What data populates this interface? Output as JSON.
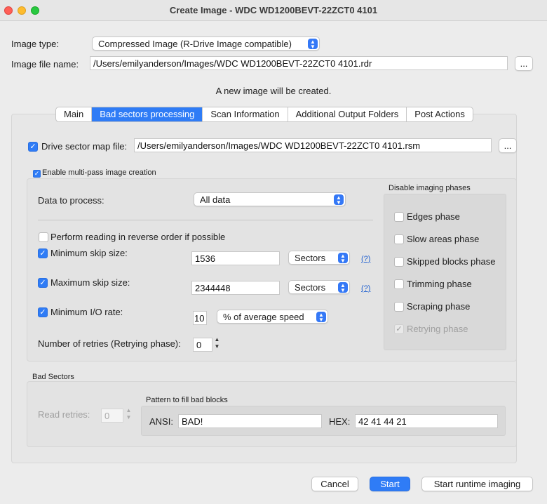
{
  "window": {
    "title": "Create Image - WDC WD1200BEVT-22ZCT0 4101"
  },
  "image_type": {
    "label": "Image type:",
    "value": "Compressed Image (R-Drive Image compatible)"
  },
  "image_file": {
    "label": "Image file name:",
    "value": "/Users/emilyanderson/Images/WDC WD1200BEVT-22ZCT0 4101.rdr",
    "browse": "..."
  },
  "notice": "A new image will be created.",
  "tabs": [
    {
      "label": "Main"
    },
    {
      "label": "Bad sectors processing",
      "active": true
    },
    {
      "label": "Scan Information"
    },
    {
      "label": "Additional Output Folders"
    },
    {
      "label": "Post Actions"
    }
  ],
  "sector_map": {
    "label": "Drive sector map file:",
    "checked": true,
    "value": "/Users/emilyanderson/Images/WDC WD1200BEVT-22ZCT0 4101.rsm",
    "browse": "..."
  },
  "multipass": {
    "label": "Enable multi-pass image creation",
    "checked": true,
    "data_to_process": {
      "label": "Data to process:",
      "value": "All data"
    },
    "reverse": {
      "label": "Perform reading in reverse order if possible",
      "checked": false
    },
    "min_skip": {
      "label": "Minimum skip size:",
      "checked": true,
      "value": "1536",
      "unit": "Sectors",
      "help": "(?)"
    },
    "max_skip": {
      "label": "Maximum skip size:",
      "checked": true,
      "value": "2344448",
      "unit": "Sectors",
      "help": "(?)"
    },
    "min_io": {
      "label": "Minimum I/O rate:",
      "checked": true,
      "value": "10",
      "unit": "% of average speed"
    },
    "retries": {
      "label": "Number of retries (Retrying phase):",
      "value": "0"
    }
  },
  "disable_phases": {
    "title": "Disable imaging phases",
    "items": [
      {
        "label": "Edges phase",
        "checked": false,
        "disabled": false
      },
      {
        "label": "Slow areas phase",
        "checked": false,
        "disabled": false
      },
      {
        "label": "Skipped blocks phase",
        "checked": false,
        "disabled": false
      },
      {
        "label": "Trimming phase",
        "checked": false,
        "disabled": false
      },
      {
        "label": "Scraping phase",
        "checked": false,
        "disabled": false
      },
      {
        "label": "Retrying phase",
        "checked": true,
        "disabled": true
      }
    ]
  },
  "bad_sectors": {
    "title": "Bad Sectors",
    "read_retries": {
      "label": "Read retries:",
      "value": "0"
    },
    "pattern": {
      "title": "Pattern to fill bad blocks",
      "ansi_label": "ANSI:",
      "ansi_value": "BAD!",
      "hex_label": "HEX:",
      "hex_value": "42 41 44 21"
    }
  },
  "buttons": {
    "cancel": "Cancel",
    "start": "Start",
    "start_runtime": "Start runtime imaging"
  },
  "icons": {
    "check": "✓",
    "chevron_updown": "⇕",
    "stepper": "⇕"
  },
  "colors": {
    "accent": "#2f7cf6",
    "close": "#ff5f57",
    "minimize": "#febc2e",
    "maximize": "#28c840",
    "link": "#2060d0"
  }
}
